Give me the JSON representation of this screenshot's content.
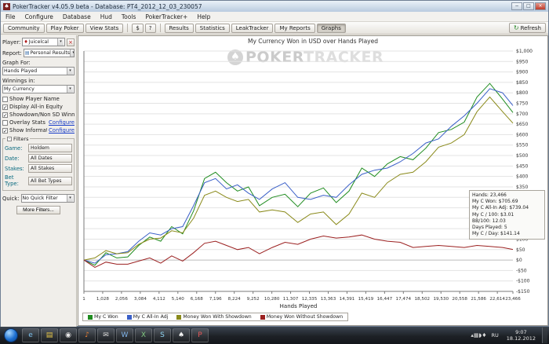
{
  "window": {
    "title": "PokerTracker v4.05.9 beta - Database: PT4_2012_12_03_230057"
  },
  "menu": {
    "items": [
      "File",
      "Configure",
      "Database",
      "Hud",
      "Tools",
      "PokerTracker+",
      "Help"
    ]
  },
  "toolbar": {
    "left_buttons": [
      "Community",
      "Play Poker",
      "View Stats"
    ],
    "small_buttons": [
      "$",
      "?"
    ],
    "tabs": [
      "Results",
      "Statistics",
      "LeakTracker",
      "My Reports",
      "Graphs"
    ],
    "active_tab": "Graphs",
    "refresh_label": "Refresh"
  },
  "sidebar": {
    "player_label": "Player:",
    "player_value": "Juicelcal",
    "report_label": "Report:",
    "report_value": "Personal Results",
    "graph_for_label": "Graph For:",
    "graph_for_value": "Hands Played",
    "winnings_label": "Winnings in:",
    "winnings_value": "My Currency",
    "checkboxes": [
      {
        "label": "Show Player Name",
        "checked": false
      },
      {
        "label": "Display All-in Equity",
        "checked": true
      },
      {
        "label": "Showdown/Non SD Winnings",
        "checked": true
      },
      {
        "label": "Overlay Stats",
        "checked": false,
        "link": "Configure"
      },
      {
        "label": "Show Information Box",
        "checked": true,
        "link": "Configure"
      }
    ],
    "filters_title": "Filters",
    "filters_toggle": "-",
    "filters": [
      {
        "label": "Game:",
        "value": "Holdem"
      },
      {
        "label": "Date:",
        "value": "All Dates"
      },
      {
        "label": "Stakes:",
        "value": "All Stakes"
      },
      {
        "label": "Bet Type:",
        "value": "All Bet Types"
      }
    ],
    "quick_label": "Quick:",
    "quick_value": "No Quick Filter",
    "more_filters": "More Filters..."
  },
  "watermark": {
    "spade": "♠",
    "part1": "POKER",
    "part2": "TRACKER"
  },
  "chart_data": {
    "type": "line",
    "title": "My Currency Won in USD over Hands Played",
    "xlabel": "Hands Played",
    "ylabel": "",
    "xlim": [
      1,
      23466
    ],
    "ylim": [
      -150,
      1000
    ],
    "ytick_step": 50,
    "grid": "horizontal",
    "legend_position": "bottom",
    "x_ticks": [
      1,
      1028,
      2056,
      3084,
      4112,
      5140,
      6168,
      7196,
      8224,
      9252,
      10280,
      11307,
      12335,
      13363,
      14391,
      15419,
      16447,
      17474,
      18502,
      19530,
      20558,
      21586,
      22614,
      23466
    ],
    "x": [
      1,
      600,
      1200,
      1800,
      2400,
      3000,
      3600,
      4200,
      4800,
      5400,
      6000,
      6600,
      7200,
      7800,
      8400,
      9000,
      9600,
      10300,
      11000,
      11700,
      12400,
      13100,
      13800,
      14500,
      15200,
      15900,
      16600,
      17300,
      18000,
      18700,
      19400,
      20100,
      20800,
      21500,
      22200,
      22900,
      23466
    ],
    "series": [
      {
        "name": "My C Won",
        "color": "#1f8c1f",
        "values": [
          0,
          -25,
          35,
          10,
          15,
          70,
          110,
          90,
          160,
          125,
          235,
          390,
          420,
          370,
          330,
          350,
          260,
          300,
          315,
          255,
          320,
          345,
          275,
          330,
          440,
          400,
          460,
          495,
          480,
          535,
          610,
          625,
          660,
          780,
          845,
          770,
          705.69
        ]
      },
      {
        "name": "My C All-In Adj",
        "color": "#3a5fc8",
        "values": [
          0,
          -15,
          25,
          30,
          40,
          90,
          130,
          120,
          150,
          160,
          260,
          370,
          390,
          340,
          360,
          320,
          290,
          340,
          370,
          300,
          290,
          310,
          300,
          360,
          410,
          430,
          440,
          470,
          510,
          560,
          580,
          640,
          690,
          750,
          820,
          800,
          739.04
        ]
      },
      {
        "name": "Money Won With Showdown",
        "color": "#8a8a1a",
        "values": [
          0,
          10,
          45,
          30,
          35,
          75,
          100,
          105,
          140,
          130,
          200,
          310,
          330,
          300,
          280,
          290,
          230,
          240,
          230,
          180,
          220,
          230,
          170,
          220,
          320,
          300,
          370,
          410,
          420,
          470,
          540,
          560,
          600,
          710,
          780,
          710,
          655
        ]
      },
      {
        "name": "Money Won Without Showdown",
        "color": "#9b2020",
        "values": [
          0,
          -35,
          -10,
          -20,
          -20,
          -5,
          10,
          -15,
          20,
          -5,
          35,
          80,
          90,
          70,
          50,
          60,
          30,
          60,
          85,
          75,
          100,
          115,
          105,
          110,
          120,
          100,
          90,
          85,
          60,
          65,
          70,
          65,
          60,
          70,
          65,
          60,
          50.69
        ]
      }
    ]
  },
  "info_box": {
    "lines": [
      "Hands: 23,466",
      "My C Won: $705.69",
      "My C All-In Adj: $739.04",
      "My C / 100: $3.01",
      "BB/100: 12.03",
      "Days Played: 5",
      "My C / Day: $141.14"
    ]
  },
  "taskbar": {
    "icons": [
      {
        "name": "browser-icon",
        "glyph": "e",
        "color": "#7ec3f0"
      },
      {
        "name": "folder-icon",
        "glyph": "▤",
        "color": "#e8c84a"
      },
      {
        "name": "media-player-icon",
        "glyph": "◉",
        "color": "#e4e4e4"
      },
      {
        "name": "music-app-icon",
        "glyph": "♪",
        "color": "#f08030"
      },
      {
        "name": "mail-app-icon",
        "glyph": "✉",
        "color": "#d8d8d8"
      },
      {
        "name": "word-app-icon",
        "glyph": "W",
        "color": "#7fb2e8"
      },
      {
        "name": "excel-app-icon",
        "glyph": "X",
        "color": "#7fc87f"
      },
      {
        "name": "chat-app-icon",
        "glyph": "S",
        "color": "#8fd4f2"
      },
      {
        "name": "poker-client-icon",
        "glyph": "♠",
        "color": "#f0f0f0"
      },
      {
        "name": "pokertracker-app-icon",
        "glyph": "P",
        "color": "#e85858"
      }
    ],
    "tray_icons": [
      {
        "name": "hidden-icons-chevron",
        "glyph": "▴"
      },
      {
        "name": "update-tray-icon",
        "glyph": "▦"
      },
      {
        "name": "volume-tray-icon",
        "glyph": "◗"
      },
      {
        "name": "network-tray-icon",
        "glyph": "♦"
      }
    ],
    "language": "RU",
    "clock_time": "9:07",
    "clock_date": "18.12.2012"
  }
}
